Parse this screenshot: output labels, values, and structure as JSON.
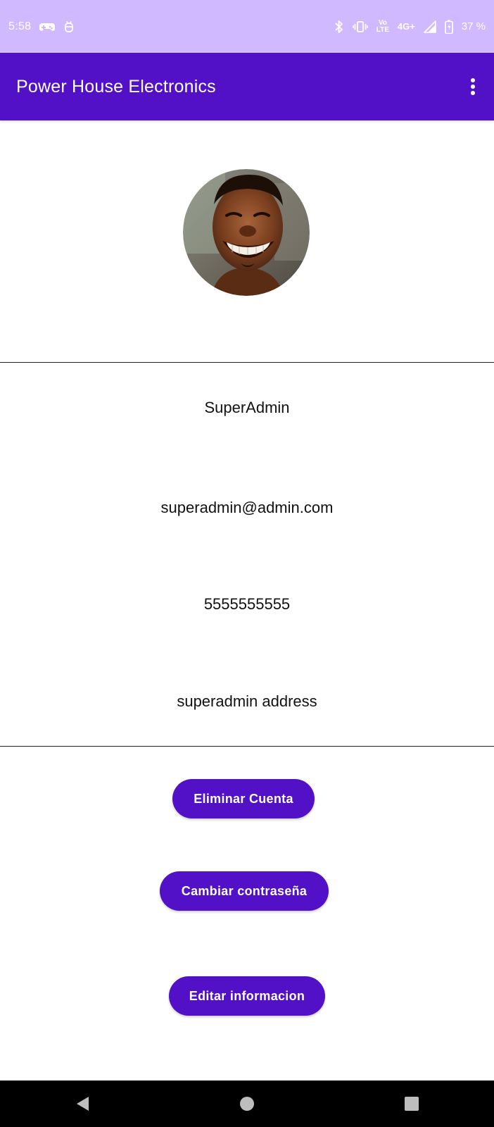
{
  "status_bar": {
    "time": "5:58",
    "network_label": "4G+",
    "volte_label": "Vo LTE",
    "battery_percent": "37 %",
    "icons": [
      "game-controller-icon",
      "bug-icon",
      "bluetooth-icon",
      "vibrate-icon",
      "signal-icon",
      "battery-icon"
    ]
  },
  "app_bar": {
    "title": "Power House Electronics",
    "menu_icon": "more-vert-icon"
  },
  "profile": {
    "username": "SuperAdmin",
    "email": "superadmin@admin.com",
    "phone": "5555555555",
    "address": "superadmin address"
  },
  "actions": {
    "delete_account": "Eliminar Cuenta",
    "change_password": "Cambiar contraseña",
    "edit_info": "Editar informacion"
  },
  "colors": {
    "status_bar": "#d0b9ff",
    "primary": "#5211c7",
    "nav_bar": "#000000"
  },
  "nav_bar": {
    "icons": [
      "back-icon",
      "home-icon",
      "recents-icon"
    ]
  }
}
